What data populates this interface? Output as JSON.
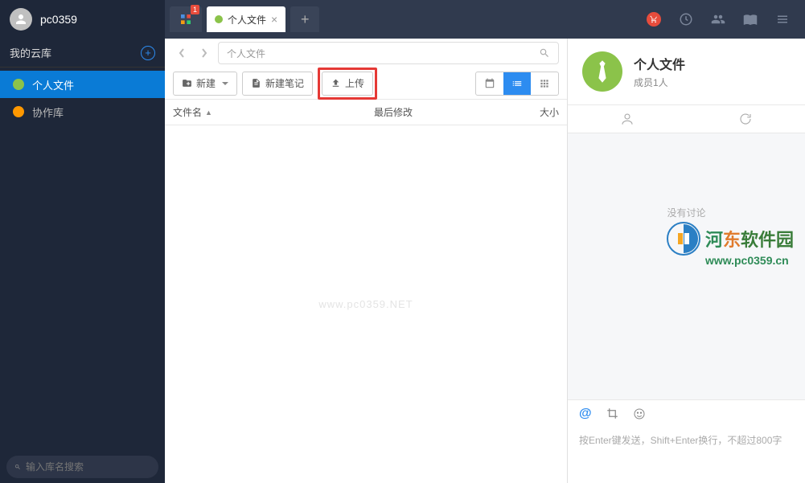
{
  "user": {
    "name": "pc0359"
  },
  "sidebar": {
    "cloud_label": "我的云库",
    "items": [
      {
        "label": "个人文件"
      },
      {
        "label": "协作库"
      }
    ],
    "search_placeholder": "输入库名搜索"
  },
  "tabs": {
    "home_badge": "1",
    "active_label": "个人文件"
  },
  "nav": {
    "breadcrumb": "个人文件"
  },
  "toolbar": {
    "new_label": "新建",
    "note_label": "新建笔记",
    "upload_label": "上传"
  },
  "table": {
    "col_name": "文件名",
    "col_modified": "最后修改",
    "col_size": "大小"
  },
  "watermark_text": "www.pc0359.NET",
  "right_panel": {
    "title": "个人文件",
    "members": "成员1人",
    "no_comments": "没有讨论",
    "logo_text": "河东软件园",
    "logo_url": "www.pc0359.cn",
    "input_placeholder": "按Enter键发送，Shift+Enter换行，不超过800字"
  }
}
